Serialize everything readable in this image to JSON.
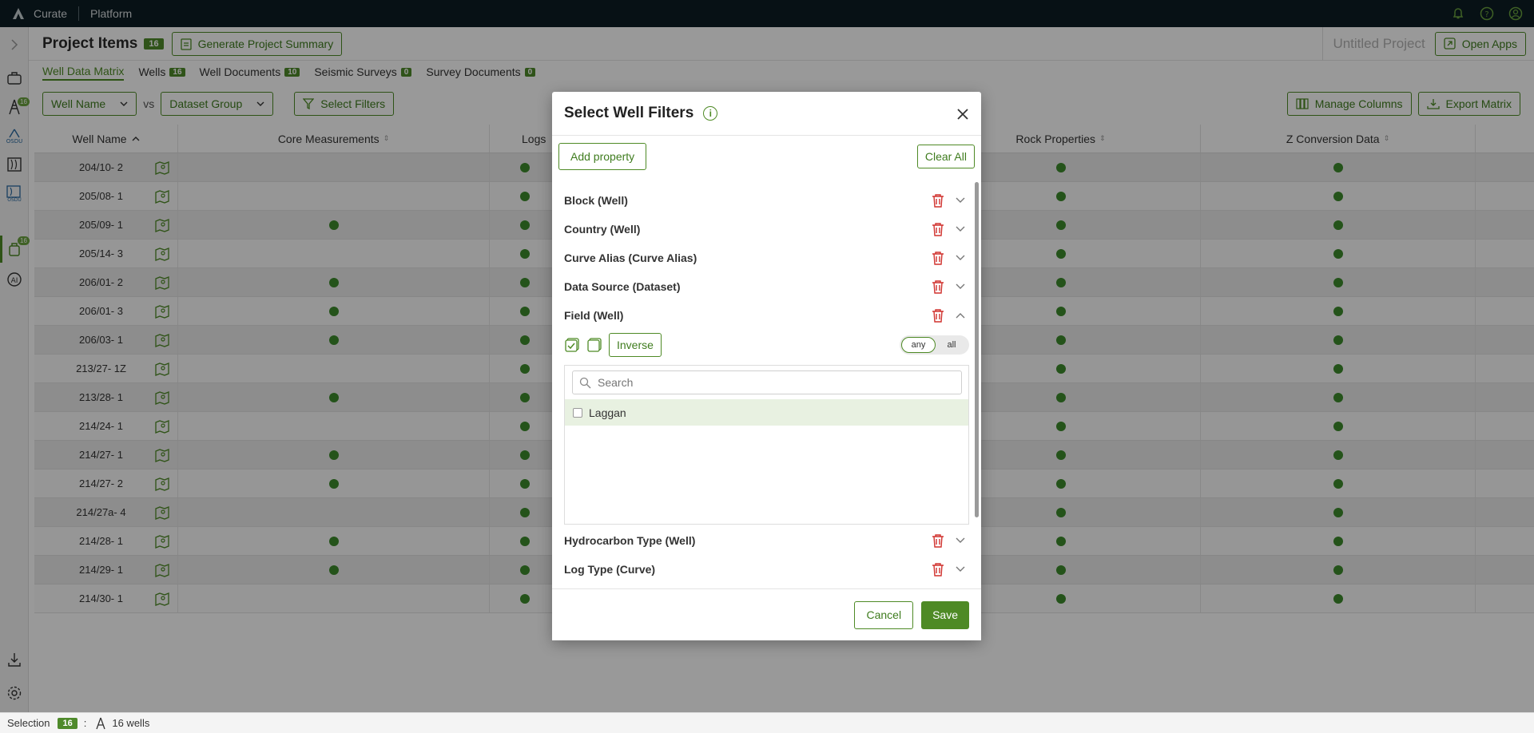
{
  "topbar": {
    "app_name": "Curate",
    "platform": "Platform"
  },
  "header": {
    "title": "Project Items",
    "count": "16",
    "generate_label": "Generate Project Summary",
    "project_name": "Untitled Project",
    "open_apps_label": "Open Apps"
  },
  "tabs": [
    {
      "label": "Well Data Matrix",
      "count": ""
    },
    {
      "label": "Wells",
      "count": "16"
    },
    {
      "label": "Well Documents",
      "count": "10"
    },
    {
      "label": "Seismic Surveys",
      "count": "0"
    },
    {
      "label": "Survey Documents",
      "count": "0"
    }
  ],
  "toolbar": {
    "row_select": "Well Name",
    "vs": "vs",
    "col_select": "Dataset Group",
    "filters_label": "Select Filters",
    "manage_columns_label": "Manage Columns",
    "export_label": "Export Matrix"
  },
  "table": {
    "headers": {
      "name": "Well Name",
      "core": "Core Measurements",
      "logs": "Logs",
      "rock": "Rock Properties",
      "z": "Z Conversion Data"
    },
    "rows": [
      {
        "name": "204/10- 2",
        "core": false
      },
      {
        "name": "205/08- 1",
        "core": false
      },
      {
        "name": "205/09- 1",
        "core": true
      },
      {
        "name": "205/14- 3",
        "core": false
      },
      {
        "name": "206/01- 2",
        "core": true
      },
      {
        "name": "206/01- 3",
        "core": true
      },
      {
        "name": "206/03- 1",
        "core": true
      },
      {
        "name": "213/27- 1Z",
        "core": false
      },
      {
        "name": "213/28- 1",
        "core": true
      },
      {
        "name": "214/24- 1",
        "core": false
      },
      {
        "name": "214/27- 1",
        "core": true
      },
      {
        "name": "214/27- 2",
        "core": true
      },
      {
        "name": "214/27a- 4",
        "core": false
      },
      {
        "name": "214/28- 1",
        "core": true
      },
      {
        "name": "214/29- 1",
        "core": true
      },
      {
        "name": "214/30- 1",
        "core": false
      }
    ]
  },
  "status": {
    "label": "Selection",
    "count": "16",
    "colon": ":",
    "wells": "16 wells"
  },
  "modal": {
    "title": "Select Well Filters",
    "add_property": "Add property",
    "clear_all": "Clear All",
    "properties_before": [
      "Block (Well)",
      "Country (Well)",
      "Curve Alias (Curve Alias)",
      "Data Source (Dataset)"
    ],
    "expanded_property": "Field (Well)",
    "inverse_label": "Inverse",
    "toggle_any": "any",
    "toggle_all": "all",
    "search_placeholder": "Search",
    "options": [
      "Laggan"
    ],
    "properties_after": [
      "Hydrocarbon Type (Well)",
      "Log Type (Curve)"
    ],
    "cancel_label": "Cancel",
    "save_label": "Save"
  },
  "colors": {
    "accent": "#4e8a25",
    "dot": "#3c8a2c",
    "danger": "#d0312d"
  }
}
